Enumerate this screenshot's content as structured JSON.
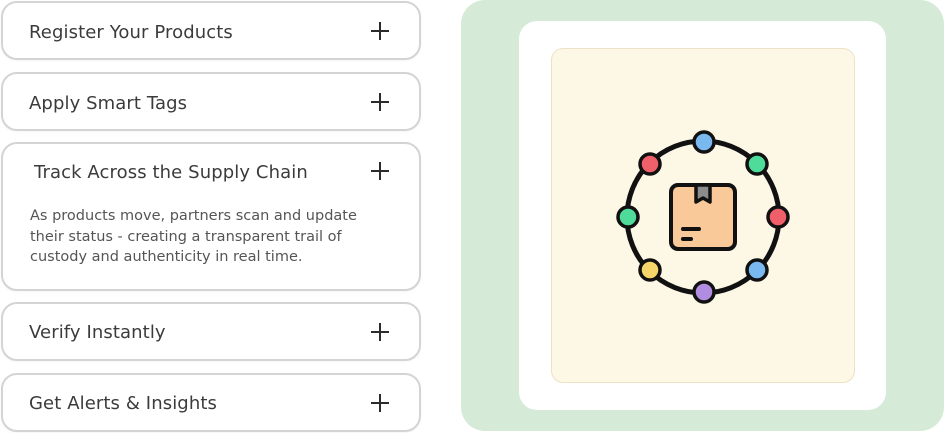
{
  "accordion": {
    "items": [
      {
        "title": "Register Your Products",
        "expanded": false,
        "icon": "plus-icon"
      },
      {
        "title": "Apply Smart Tags",
        "expanded": false,
        "icon": "plus-icon"
      },
      {
        "title": "Track Across the Supply Chain",
        "expanded": true,
        "icon": "plus-icon",
        "body": "As products move, partners scan and update their status - creating a transparent trail of custody and authenticity in real time."
      },
      {
        "title": "Verify Instantly",
        "expanded": false,
        "icon": "plus-icon"
      },
      {
        "title": "Get Alerts & Insights",
        "expanded": false,
        "icon": "plus-icon"
      }
    ]
  },
  "visual": {
    "icon": "supply-chain-network-icon",
    "colors": {
      "panel_bg": "#d5ebd8",
      "card_bg": "#ffffff",
      "inner_bg": "#fdf7e6",
      "box": "#f9c99a",
      "node_red": "#f0606a",
      "node_blue": "#7ab8f0",
      "node_green": "#4fdb9a",
      "node_yellow": "#f6d66a",
      "node_purple": "#b08de0",
      "outline": "#111111"
    }
  }
}
